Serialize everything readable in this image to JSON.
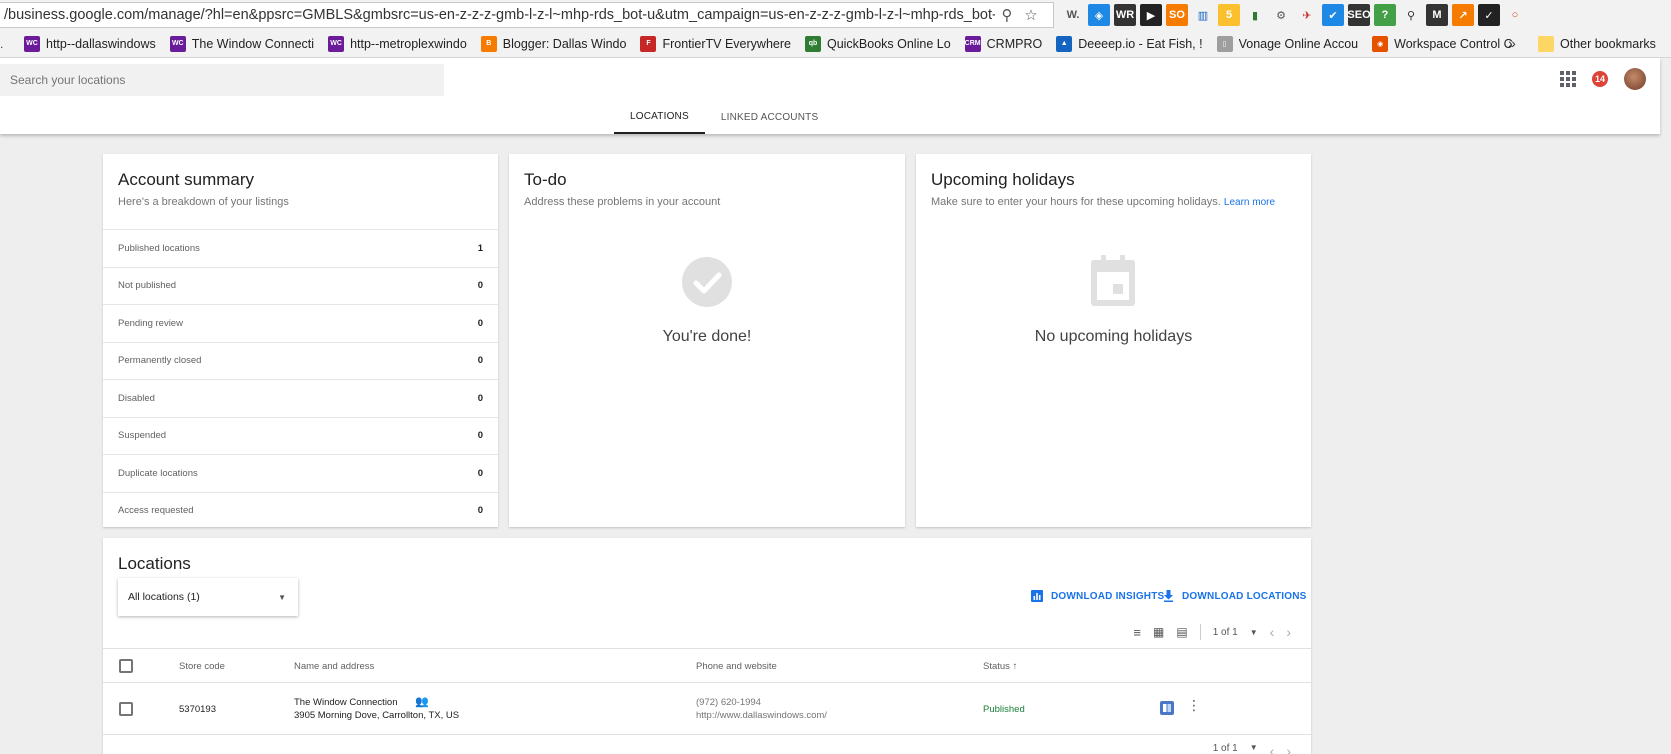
{
  "browser": {
    "url": "/business.google.com/manage/?hl=en&ppsrc=GMBLS&gmbsrc=us-en-z-z-z-gmb-l-z-l~mhp-rds_bot-u&utm_campaign=us-en-z-z-z-gmb-l-z-l~mhp-rds_bot-...",
    "extensions": [
      {
        "label": "W.",
        "color": "#555555",
        "bg": "transparent"
      },
      {
        "label": "◈",
        "color": "#ffffff",
        "bg": "#1e88e5"
      },
      {
        "label": "WR",
        "color": "#ffffff",
        "bg": "#333333"
      },
      {
        "label": "▶",
        "color": "#ffffff",
        "bg": "#222222"
      },
      {
        "label": "SO",
        "color": "#ffffff",
        "bg": "#f57c00"
      },
      {
        "label": "▥",
        "color": "#1565c0",
        "bg": "transparent"
      },
      {
        "label": "5",
        "color": "#ffffff",
        "bg": "#fbc02d"
      },
      {
        "label": "▮",
        "color": "#2e7d32",
        "bg": "transparent"
      },
      {
        "label": "⚙",
        "color": "#555555",
        "bg": "transparent"
      },
      {
        "label": "✈",
        "color": "#c62828",
        "bg": "transparent"
      },
      {
        "label": "✔",
        "color": "#ffffff",
        "bg": "#1e88e5"
      },
      {
        "label": "SEO",
        "color": "#ffffff",
        "bg": "#333333"
      },
      {
        "label": "?",
        "color": "#ffffff",
        "bg": "#43a047"
      },
      {
        "label": "⚲",
        "color": "#333333",
        "bg": "transparent"
      },
      {
        "label": "M",
        "color": "#ffffff",
        "bg": "#333333"
      },
      {
        "label": "↗",
        "color": "#ffffff",
        "bg": "#f57c00"
      },
      {
        "label": "✓",
        "color": "#ffffff",
        "bg": "#222222"
      },
      {
        "label": "○",
        "color": "#d84315",
        "bg": "transparent"
      }
    ]
  },
  "bookmarks": [
    {
      "label": "http--dallaswindows",
      "icon": "WC",
      "color": "#6a1b9a"
    },
    {
      "label": "The Window Connecti",
      "icon": "WC",
      "color": "#6a1b9a"
    },
    {
      "label": "http--metroplexwindo",
      "icon": "WC",
      "color": "#6a1b9a"
    },
    {
      "label": "Blogger: Dallas Windo",
      "icon": "B",
      "color": "#f57c00"
    },
    {
      "label": "FrontierTV Everywhere",
      "icon": "F",
      "color": "#c62828"
    },
    {
      "label": "QuickBooks Online Lo",
      "icon": "qb",
      "color": "#2e7d32"
    },
    {
      "label": "CRMPRO",
      "icon": "CRM",
      "color": "#6a1b9a"
    },
    {
      "label": "Deeeep.io - Eat Fish, !",
      "icon": "▲",
      "color": "#1565c0"
    },
    {
      "label": "Vonage Online Accou",
      "icon": "▯",
      "color": "#9e9e9e"
    },
    {
      "label": "Workspace Control C",
      "icon": "◉",
      "color": "#e65100"
    }
  ],
  "bookmarks_overflow": "»",
  "other_bookmarks": "Other bookmarks",
  "header": {
    "search_placeholder": "Search your locations",
    "notification_count": "14",
    "tabs": [
      "LOCATIONS",
      "LINKED ACCOUNTS"
    ]
  },
  "account_summary": {
    "title": "Account summary",
    "subtitle": "Here's a breakdown of your listings",
    "rows": [
      {
        "label": "Published locations",
        "value": "1"
      },
      {
        "label": "Not published",
        "value": "0"
      },
      {
        "label": "Pending review",
        "value": "0"
      },
      {
        "label": "Permanently closed",
        "value": "0"
      },
      {
        "label": "Disabled",
        "value": "0"
      },
      {
        "label": "Suspended",
        "value": "0"
      },
      {
        "label": "Duplicate locations",
        "value": "0"
      },
      {
        "label": "Access requested",
        "value": "0"
      }
    ]
  },
  "todo": {
    "title": "To-do",
    "subtitle": "Address these problems in your account",
    "message": "You're done!"
  },
  "holidays": {
    "title": "Upcoming holidays",
    "subtitle": "Make sure to enter your hours for these upcoming holidays.",
    "link": "Learn more",
    "message": "No upcoming holidays"
  },
  "locations": {
    "title": "Locations",
    "filter": "All locations (1)",
    "download_insights": "DOWNLOAD INSIGHTS",
    "download_locations": "DOWNLOAD LOCATIONS",
    "pager": "1 of 1",
    "columns": {
      "store_code": "Store code",
      "name": "Name and address",
      "phone": "Phone and website",
      "status": "Status ↑"
    },
    "row": {
      "store_code": "5370193",
      "name": "The Window Connection",
      "address": "3905 Morning Dove, Carrollton, TX, US",
      "phone": "(972) 620-1994",
      "website": "http://www.dallaswindows.com/",
      "status": "Published"
    }
  },
  "colors": {
    "accent": "#1a73e8",
    "published": "#188038",
    "badge": "#db4437"
  }
}
